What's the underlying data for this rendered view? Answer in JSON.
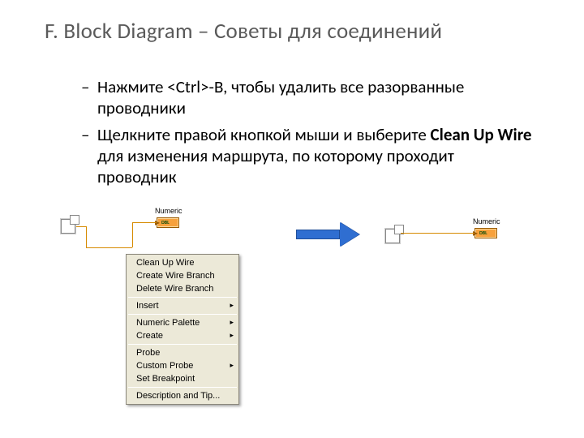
{
  "title": "F. Block Diagram – Советы для соединений",
  "bullets": {
    "b1_pre": "Нажмите ",
    "b1_kbd": "<Ctrl>",
    "b1_post": "-B, чтобы удалить все разорванные проводники",
    "b2_pre": "Щелкните правой кнопкой мыши и выберите ",
    "b2_bold": "Clean Up Wire",
    "b2_post": " для изменения маршрута, по которому проходит проводник"
  },
  "labview": {
    "control_label": "Numeric",
    "indicator_label": "Numeric",
    "dbl": "DBL"
  },
  "menu": {
    "items": [
      {
        "label": "Clean Up Wire",
        "sub": false
      },
      {
        "label": "Create Wire Branch",
        "sub": false
      },
      {
        "label": "Delete Wire Branch",
        "sub": false
      },
      {
        "sep": true
      },
      {
        "label": "Insert",
        "sub": true
      },
      {
        "sep": true
      },
      {
        "label": "Numeric Palette",
        "sub": true
      },
      {
        "label": "Create",
        "sub": true
      },
      {
        "sep": true
      },
      {
        "label": "Probe",
        "sub": false
      },
      {
        "label": "Custom Probe",
        "sub": true
      },
      {
        "label": "Set Breakpoint",
        "sub": false
      },
      {
        "sep": true
      },
      {
        "label": "Description and Tip...",
        "sub": false
      }
    ]
  }
}
